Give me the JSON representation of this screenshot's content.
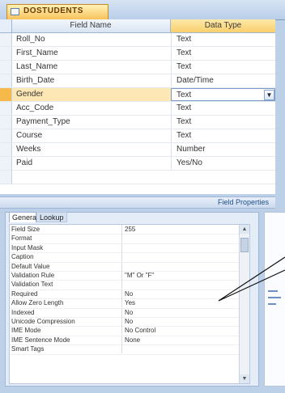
{
  "tab": {
    "title": "DOSTUDENTS",
    "icon": "table-icon"
  },
  "grid": {
    "headers": [
      "Field Name",
      "Data Type"
    ],
    "rows": [
      {
        "name": "Roll_No",
        "type": "Text"
      },
      {
        "name": "First_Name",
        "type": "Text"
      },
      {
        "name": "Last_Name",
        "type": "Text"
      },
      {
        "name": "Birth_Date",
        "type": "Date/Time"
      },
      {
        "name": "Gender",
        "type": "Text"
      },
      {
        "name": "Acc_Code",
        "type": "Text"
      },
      {
        "name": "Payment_Type",
        "type": "Text"
      },
      {
        "name": "Course",
        "type": "Text"
      },
      {
        "name": "Weeks",
        "type": "Number"
      },
      {
        "name": "Paid",
        "type": "Yes/No"
      }
    ],
    "selected_row_name": "Gender",
    "dropdown_icon": "chevron-down-icon"
  },
  "field_properties": {
    "label": "Field Properties",
    "tabs": [
      "General",
      "Lookup"
    ],
    "active_tab": "General",
    "rows": [
      {
        "name": "Field Size",
        "value": "255"
      },
      {
        "name": "Format",
        "value": ""
      },
      {
        "name": "Input Mask",
        "value": ""
      },
      {
        "name": "Caption",
        "value": ""
      },
      {
        "name": "Default Value",
        "value": ""
      },
      {
        "name": "Validation Rule",
        "value": "\"M\" Or \"F\""
      },
      {
        "name": "Validation Text",
        "value": ""
      },
      {
        "name": "Required",
        "value": "No"
      },
      {
        "name": "Allow Zero Length",
        "value": "Yes"
      },
      {
        "name": "Indexed",
        "value": "No"
      },
      {
        "name": "Unicode Compression",
        "value": "No"
      },
      {
        "name": "IME Mode",
        "value": "No Control"
      },
      {
        "name": "IME Sentence Mode",
        "value": "None"
      },
      {
        "name": "Smart Tags",
        "value": ""
      }
    ],
    "scroll_up_icon": "scroll-up-icon",
    "scroll_down_icon": "scroll-down-icon"
  },
  "colors": {
    "tab_accent": "#f8c25c",
    "selected_row": "#fde7b4",
    "border": "#9fb6d6"
  }
}
